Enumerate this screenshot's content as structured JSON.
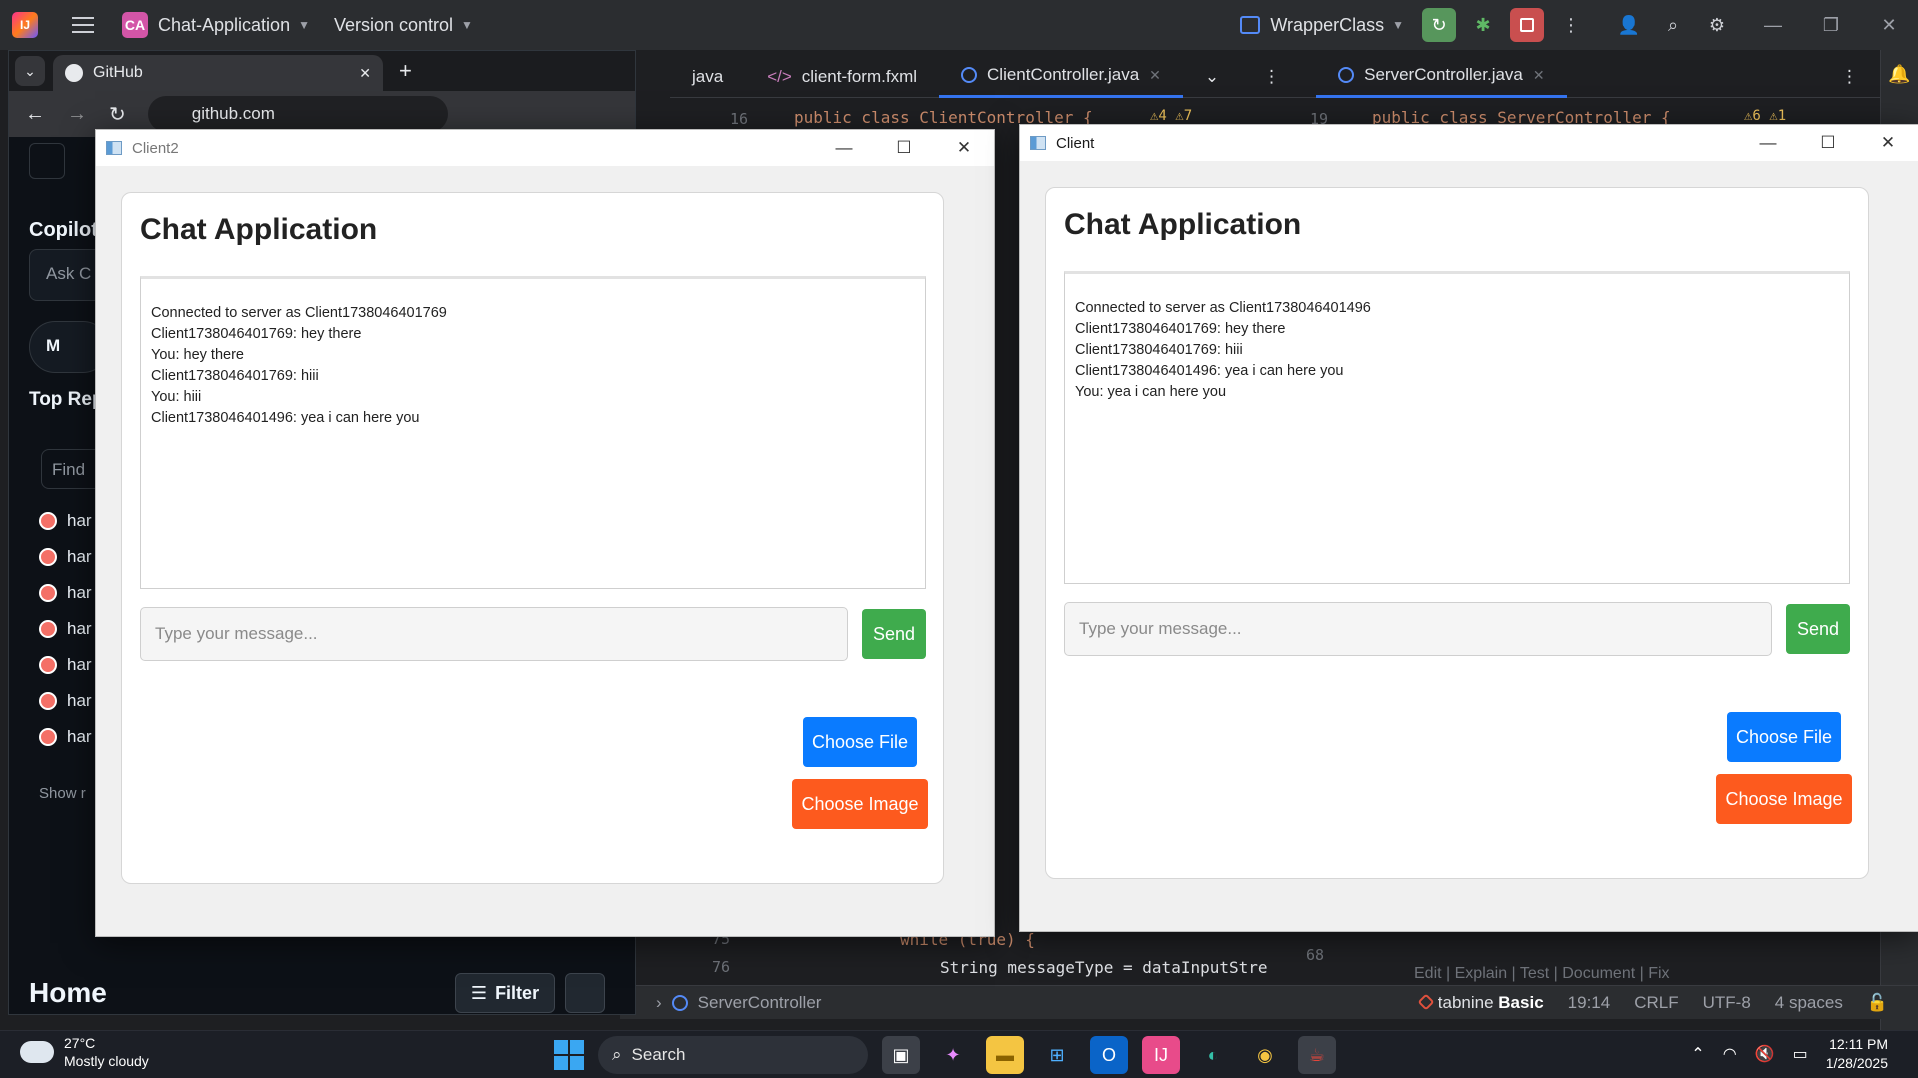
{
  "ide": {
    "project_badge": "CA",
    "project_name": "Chat-Application",
    "vcs_label": "Version control",
    "run_config": "WrapperClass",
    "tabs": [
      {
        "label": "java"
      },
      {
        "label": "client-form.fxml"
      },
      {
        "label": "ClientController.java"
      },
      {
        "label": "ServerController.java"
      }
    ],
    "code_left": {
      "line_no": "16",
      "text": "public class ClientController {"
    },
    "code_right": {
      "line_no": "19",
      "text": "public class ServerController {"
    },
    "code_bottom_1": {
      "line_no": "75",
      "text": "while (true) {"
    },
    "code_bottom_2": {
      "line_no": "76",
      "text": "String messageType = dataInputStre"
    },
    "code_bottom_3": {
      "line_no": "68"
    },
    "warnings_left": "⚠4 ⚠7",
    "warnings_right": "⚠6 ⚠1",
    "hint_row": "Edit | Explain | Test | Document | Fix",
    "status": {
      "breadcrumb": "ServerController",
      "tabnine_label": "tabnine",
      "tabnine_plan": "Basic",
      "position": "19:14",
      "line_sep": "CRLF",
      "encoding": "UTF-8",
      "indent": "4 spaces"
    }
  },
  "chrome": {
    "tab_title": "GitHub",
    "url": "github.com",
    "sidebar": {
      "copilot_heading": "Copilot",
      "ask_placeholder": "Ask C",
      "merge_label": "M",
      "top_repos_heading": "Top Rep",
      "find_placeholder": "Find",
      "repo_prefix": "har",
      "show_more": "Show r",
      "home_heading": "Home",
      "filter_label": "Filter"
    }
  },
  "client2": {
    "window_title": "Client2",
    "heading": "Chat Application",
    "messages": [
      "Connected to server as Client1738046401769",
      "Client1738046401769: hey there",
      "You: hey there",
      "Client1738046401769: hiii",
      "You: hiii",
      "Client1738046401496: yea i can here you"
    ],
    "input_placeholder": "Type your message...",
    "send_label": "Send",
    "choose_file_label": "Choose File",
    "choose_image_label": "Choose Image"
  },
  "client": {
    "window_title": "Client",
    "heading": "Chat Application",
    "messages": [
      "Connected to server as Client1738046401496",
      "Client1738046401769: hey there",
      "Client1738046401769: hiii",
      "Client1738046401496: yea i can here you",
      "You: yea i can here you"
    ],
    "input_placeholder": "Type your message...",
    "send_label": "Send",
    "choose_file_label": "Choose File",
    "choose_image_label": "Choose Image"
  },
  "taskbar": {
    "temperature": "27°C",
    "weather": "Mostly cloudy",
    "search_label": "Search",
    "time": "12:11 PM",
    "date": "1/28/2025"
  },
  "colors": {
    "send_green": "#3fab4d",
    "file_blue": "#0a7bff",
    "image_orange": "#fd5a1e",
    "ide_bg": "#1e1f22"
  }
}
